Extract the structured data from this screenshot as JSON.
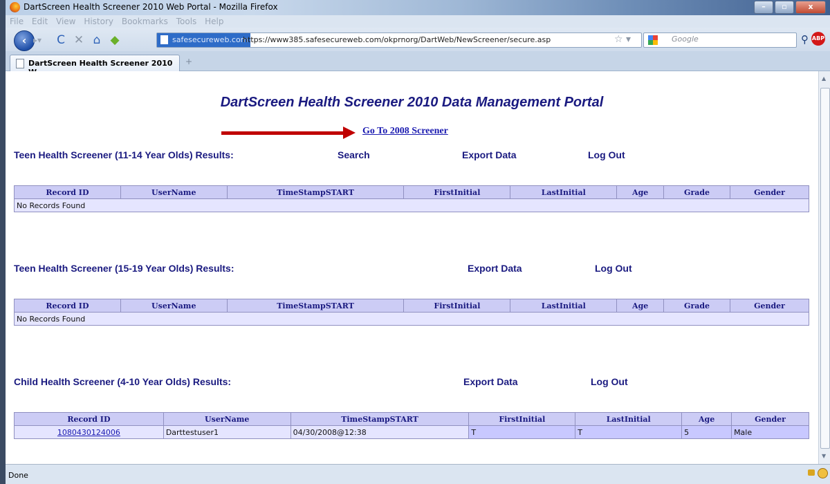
{
  "window": {
    "title": "DartScreen Health Screener 2010 Web Portal - Mozilla Firefox"
  },
  "menu": [
    "File",
    "Edit",
    "View",
    "History",
    "Bookmarks",
    "Tools",
    "Help"
  ],
  "navbar": {
    "site_badge": "safesecureweb.com",
    "url": "https://www385.safesecureweb.com/okprnorg/DartWeb/NewScreener/secure.asp",
    "search_placeholder": "Google",
    "adblock_label": "ABP"
  },
  "tab": {
    "label": "DartScreen Health Screener 2010 W..."
  },
  "page": {
    "title": "DartScreen Health Screener 2010 Data Management Portal",
    "goto_link": "Go To 2008 Screener",
    "accent_color": "#1a1a80",
    "arrow_color": "#c00000"
  },
  "sections": [
    {
      "title": "Teen Health Screener (11-14 Year Olds) Results:",
      "search": "Search",
      "export": "Export Data",
      "logout": "Log Out",
      "columns": [
        "Record ID",
        "UserName",
        "TimeStampSTART",
        "FirstInitial",
        "LastInitial",
        "Age",
        "Grade",
        "Gender"
      ],
      "empty_text": "No Records Found"
    },
    {
      "title": "Teen Health Screener (15-19 Year Olds) Results:",
      "export": "Export Data",
      "logout": "Log Out",
      "columns": [
        "Record ID",
        "UserName",
        "TimeStampSTART",
        "FirstInitial",
        "LastInitial",
        "Age",
        "Grade",
        "Gender"
      ],
      "empty_text": "No Records Found"
    },
    {
      "title": "Child Health Screener (4-10 Year Olds) Results:",
      "export": "Export Data",
      "logout": "Log Out",
      "columns": [
        "Record ID",
        "UserName",
        "TimeStampSTART",
        "FirstInitial",
        "LastInitial",
        "Age",
        "Gender"
      ],
      "row": {
        "record_id": "1080430124006",
        "username": "Darttestuser1",
        "timestamp": "04/30/2008@12:38",
        "first_initial": "T",
        "last_initial": "T",
        "age": "5",
        "gender": "Male"
      }
    }
  ],
  "status": {
    "text": "Done"
  }
}
